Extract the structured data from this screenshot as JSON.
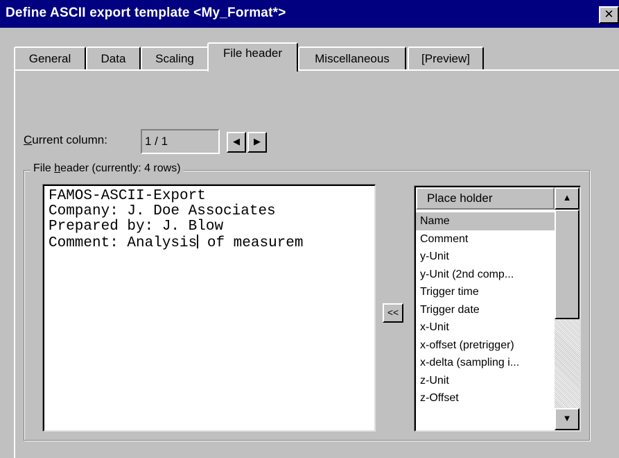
{
  "window": {
    "title": "Define ASCII export template <My_Format*>",
    "close_glyph": "✕"
  },
  "tabs": [
    {
      "label": "General",
      "active": false
    },
    {
      "label": "Data",
      "active": false
    },
    {
      "label": "Scaling",
      "active": false
    },
    {
      "label": "File header",
      "active": true
    },
    {
      "label": "Miscellaneous",
      "active": false
    },
    {
      "label": "[Preview]",
      "active": false
    }
  ],
  "current_column": {
    "label_mnemonic": "C",
    "label_rest": "urrent column:",
    "value": "1 / 1",
    "prev_icon": "◀",
    "next_icon": "▶"
  },
  "file_header": {
    "caption_pre": "File ",
    "caption_mnemonic": "h",
    "caption_post": "eader  (currently: 4 rows)",
    "lines": [
      "FAMOS-ASCII-Export",
      "Company: J. Doe Associates",
      "Prepared by: J. Blow",
      "Comment: Analysis of measurem"
    ],
    "caret_after": "Comment: Analysis",
    "caret_rest": " of measurem",
    "insert_button": "<<"
  },
  "placeholders": {
    "header": "Place holder",
    "items": [
      "Name",
      "Comment",
      "y-Unit",
      "y-Unit (2nd comp...",
      "Trigger time",
      "Trigger date",
      "x-Unit",
      "x-offset (pretrigger)",
      "x-delta (sampling i...",
      "z-Unit",
      "z-Offset"
    ],
    "selected_index": 0,
    "scroll_up_icon": "▲",
    "scroll_down_icon": "▼"
  },
  "colors": {
    "title_bar": "#000080",
    "dialog_face": "#c0c0c0"
  }
}
